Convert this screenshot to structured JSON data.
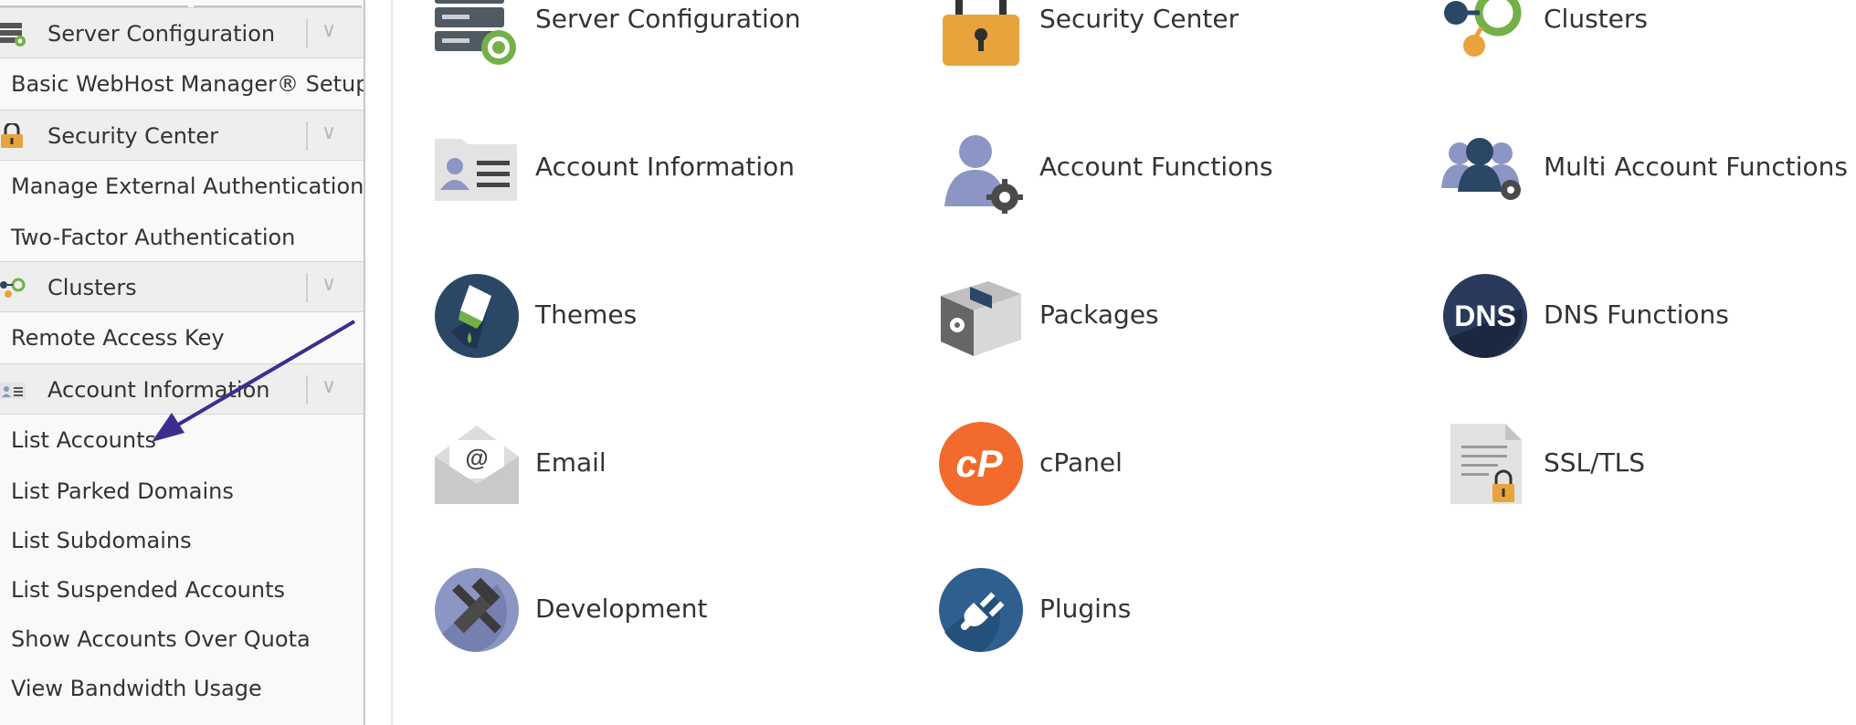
{
  "sidebar": {
    "categories": [
      {
        "label": "Server Configuration",
        "icon": "server-config-icon",
        "items": [
          "Basic WebHost Manager® Setup"
        ]
      },
      {
        "label": "Security Center",
        "icon": "padlock-icon",
        "items": [
          "Manage External Authentications",
          "Two-Factor Authentication"
        ]
      },
      {
        "label": "Clusters",
        "icon": "clusters-icon",
        "items": [
          "Remote Access Key"
        ]
      },
      {
        "label": "Account Information",
        "icon": "account-card-icon",
        "items": [
          "List Accounts",
          "List Parked Domains",
          "List Subdomains",
          "List Suspended Accounts",
          "Show Accounts Over Quota",
          "View Bandwidth Usage"
        ]
      }
    ],
    "chevron": "∨"
  },
  "main": {
    "tiles": [
      {
        "label": "Server Configuration",
        "icon": "server-config-icon"
      },
      {
        "label": "Security Center",
        "icon": "padlock-icon"
      },
      {
        "label": "Clusters",
        "icon": "clusters-icon"
      },
      {
        "label": "Account Information",
        "icon": "account-card-icon"
      },
      {
        "label": "Account Functions",
        "icon": "user-gear-icon"
      },
      {
        "label": "Multi Account Functions",
        "icon": "multi-user-gear-icon"
      },
      {
        "label": "Themes",
        "icon": "paint-brush-icon"
      },
      {
        "label": "Packages",
        "icon": "package-box-icon"
      },
      {
        "label": "DNS Functions",
        "icon": "dns-icon"
      },
      {
        "label": "Email",
        "icon": "envelope-icon"
      },
      {
        "label": "cPanel",
        "icon": "cpanel-logo-icon"
      },
      {
        "label": "SSL/TLS",
        "icon": "ssl-certificate-icon"
      },
      {
        "label": "Development",
        "icon": "tools-icon"
      },
      {
        "label": "Plugins",
        "icon": "plug-icon"
      }
    ]
  },
  "colors": {
    "accent_orange": "#e8a33d",
    "cpanel_orange": "#f26b2d",
    "navy": "#2a4766",
    "lavender": "#8c96c4",
    "green": "#74b04a",
    "arrow": "#3b2e8f"
  }
}
